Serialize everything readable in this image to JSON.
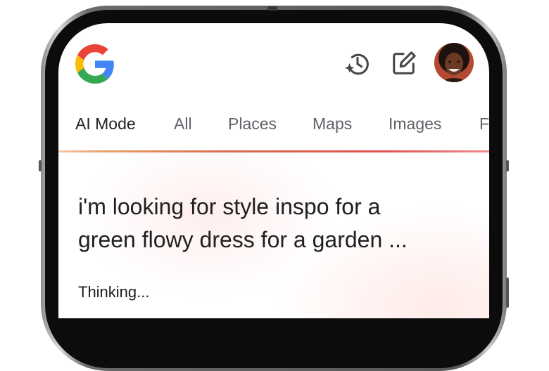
{
  "header": {
    "logo_icon": "google-g-logo",
    "history_icon": "history-sparkle-icon",
    "new_chat_icon": "edit-square-icon",
    "avatar_icon": "user-avatar"
  },
  "tabs": [
    {
      "label": "AI Mode",
      "active": true
    },
    {
      "label": "All",
      "active": false
    },
    {
      "label": "Places",
      "active": false
    },
    {
      "label": "Maps",
      "active": false
    },
    {
      "label": "Images",
      "active": false
    },
    {
      "label": "F",
      "active": false
    }
  ],
  "query": {
    "line1": "i'm looking for style inspo for a",
    "line2": "green flowy dress for a garden ..."
  },
  "status": {
    "thinking": "Thinking..."
  },
  "colors": {
    "google_blue": "#4285F4",
    "google_red": "#EA4335",
    "google_yellow": "#FBBC05",
    "google_green": "#34A853",
    "icon_gray": "#444746",
    "text_primary": "#1f1f1f",
    "text_secondary": "#5f6368"
  }
}
